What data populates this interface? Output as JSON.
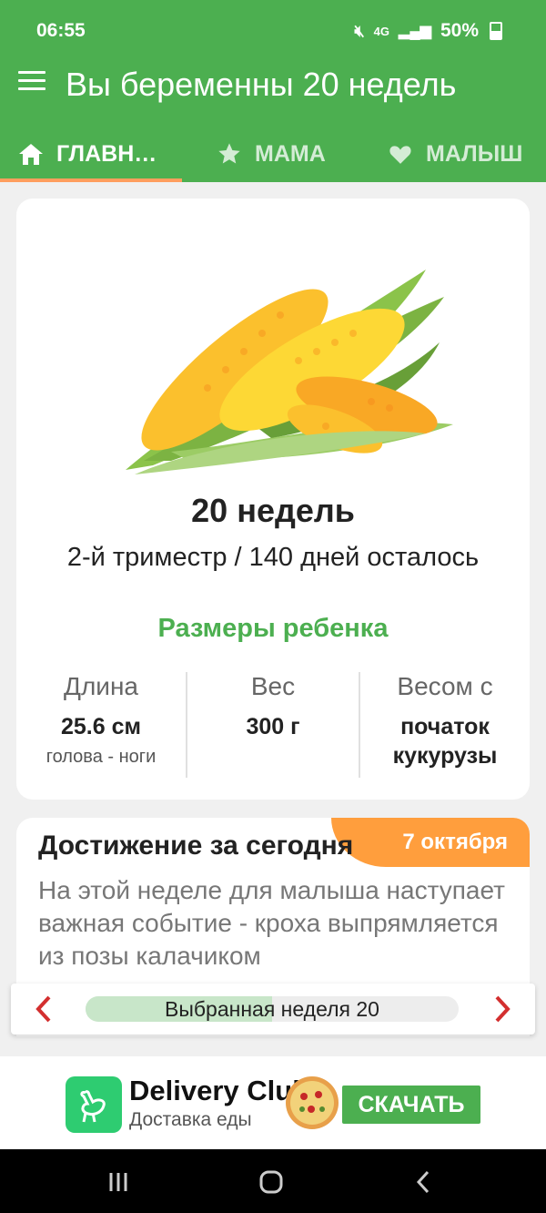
{
  "status_bar": {
    "time": "06:55",
    "network": "4G",
    "battery": "50%"
  },
  "app_bar": {
    "title": "Вы беременны 20 недель"
  },
  "tabs": [
    {
      "label": "ГЛАВН…",
      "icon": "home-icon",
      "selected": true
    },
    {
      "label": "МАМА",
      "icon": "star-icon",
      "selected": false
    },
    {
      "label": "МАЛЫШ",
      "icon": "heart-icon",
      "selected": false
    }
  ],
  "week_card": {
    "image": "corn-cob-image",
    "title": "20 недель",
    "subtitle": "2-й триместр / 140 дней осталось",
    "sizes_title": "Размеры ребенка",
    "columns": [
      {
        "label": "Длина",
        "value": "25.6 см",
        "sub": "голова - ноги"
      },
      {
        "label": "Вес",
        "value": "300 г",
        "sub": ""
      },
      {
        "label": "Весом с",
        "value": "початок кукурузы",
        "sub": ""
      }
    ]
  },
  "achievement": {
    "title": "Достижение за сегодня",
    "date": "7 октября",
    "text": "На этой неделе для малыша наступает важная событие - кроха выпрямляется из позы калачиком"
  },
  "week_selector": {
    "label": "Выбранная неделя 20",
    "progress_fraction": 0.5
  },
  "ad": {
    "title": "Delivery Club",
    "subtitle": "Доставка еды",
    "button": "СКАЧАТЬ"
  },
  "colors": {
    "primary": "#4caf50",
    "accent": "#ff9e3d",
    "arrow": "#d32f2f"
  }
}
